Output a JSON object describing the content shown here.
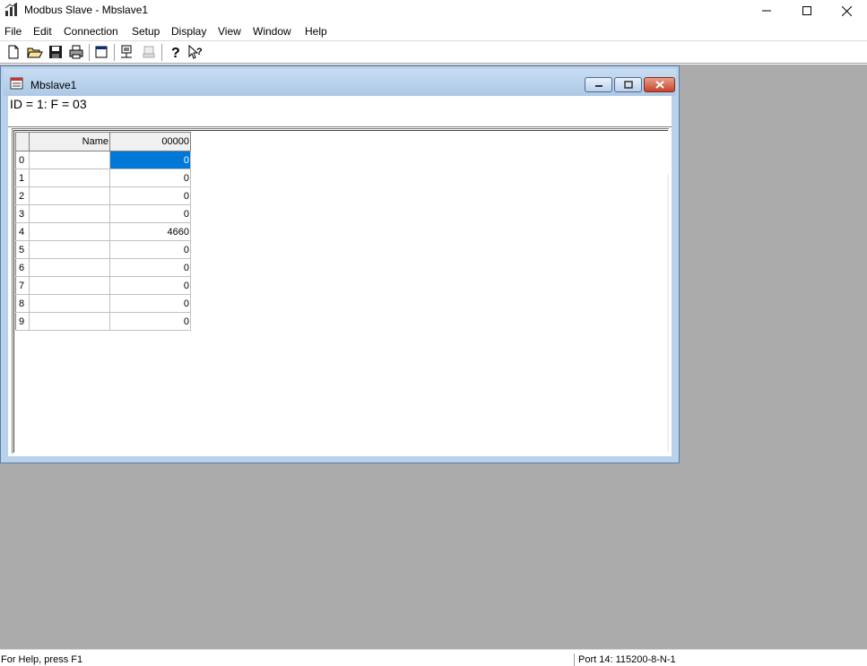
{
  "app": {
    "title": "Modbus Slave - Mbslave1"
  },
  "menu": [
    "File",
    "Edit",
    "Connection",
    "Setup",
    "Display",
    "View",
    "Window",
    "Help"
  ],
  "toolbar": {
    "icons": [
      "new-file-icon",
      "open-folder-icon",
      "save-icon",
      "print-icon",
      "window-icon",
      "connect-icon",
      "disconnect-icon",
      "help-icon",
      "context-help-icon"
    ]
  },
  "child": {
    "title": "Mbslave1",
    "id_label": "ID = 1: F = 03"
  },
  "grid": {
    "headers": {
      "name": "Name",
      "value": "00000"
    },
    "rows": [
      {
        "num": "0",
        "name": "",
        "value": "0"
      },
      {
        "num": "1",
        "name": "",
        "value": "0"
      },
      {
        "num": "2",
        "name": "",
        "value": "0"
      },
      {
        "num": "3",
        "name": "",
        "value": "0"
      },
      {
        "num": "4",
        "name": "",
        "value": "4660"
      },
      {
        "num": "5",
        "name": "",
        "value": "0"
      },
      {
        "num": "6",
        "name": "",
        "value": "0"
      },
      {
        "num": "7",
        "name": "",
        "value": "0"
      },
      {
        "num": "8",
        "name": "",
        "value": "0"
      },
      {
        "num": "9",
        "name": "",
        "value": "0"
      }
    ],
    "selected_row": 0
  },
  "status": {
    "help_text": "For Help, press F1",
    "port": "Port 14: 115200-8-N-1"
  },
  "colors": {
    "selection": "#0078d7",
    "mdi_background": "#ababab",
    "child_frame": "#b9d1ea"
  }
}
